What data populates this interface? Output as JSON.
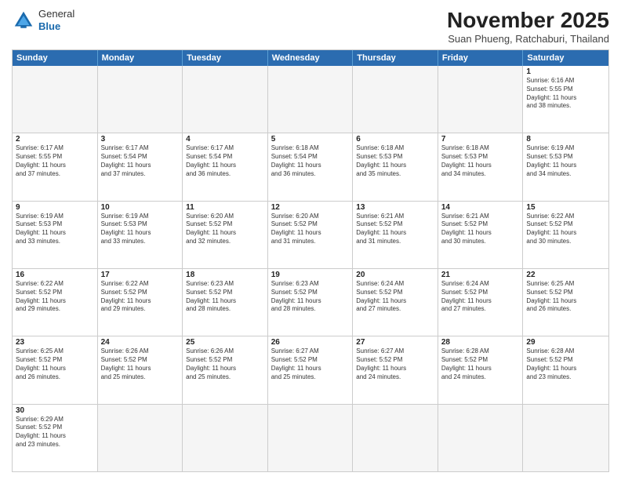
{
  "header": {
    "logo_general": "General",
    "logo_blue": "Blue",
    "month_title": "November 2025",
    "subtitle": "Suan Phueng, Ratchaburi, Thailand"
  },
  "weekdays": [
    "Sunday",
    "Monday",
    "Tuesday",
    "Wednesday",
    "Thursday",
    "Friday",
    "Saturday"
  ],
  "weeks": [
    [
      {
        "day": "",
        "info": ""
      },
      {
        "day": "",
        "info": ""
      },
      {
        "day": "",
        "info": ""
      },
      {
        "day": "",
        "info": ""
      },
      {
        "day": "",
        "info": ""
      },
      {
        "day": "",
        "info": ""
      },
      {
        "day": "1",
        "info": "Sunrise: 6:16 AM\nSunset: 5:55 PM\nDaylight: 11 hours\nand 38 minutes."
      }
    ],
    [
      {
        "day": "2",
        "info": "Sunrise: 6:17 AM\nSunset: 5:55 PM\nDaylight: 11 hours\nand 37 minutes."
      },
      {
        "day": "3",
        "info": "Sunrise: 6:17 AM\nSunset: 5:54 PM\nDaylight: 11 hours\nand 37 minutes."
      },
      {
        "day": "4",
        "info": "Sunrise: 6:17 AM\nSunset: 5:54 PM\nDaylight: 11 hours\nand 36 minutes."
      },
      {
        "day": "5",
        "info": "Sunrise: 6:18 AM\nSunset: 5:54 PM\nDaylight: 11 hours\nand 36 minutes."
      },
      {
        "day": "6",
        "info": "Sunrise: 6:18 AM\nSunset: 5:53 PM\nDaylight: 11 hours\nand 35 minutes."
      },
      {
        "day": "7",
        "info": "Sunrise: 6:18 AM\nSunset: 5:53 PM\nDaylight: 11 hours\nand 34 minutes."
      },
      {
        "day": "8",
        "info": "Sunrise: 6:19 AM\nSunset: 5:53 PM\nDaylight: 11 hours\nand 34 minutes."
      }
    ],
    [
      {
        "day": "9",
        "info": "Sunrise: 6:19 AM\nSunset: 5:53 PM\nDaylight: 11 hours\nand 33 minutes."
      },
      {
        "day": "10",
        "info": "Sunrise: 6:19 AM\nSunset: 5:53 PM\nDaylight: 11 hours\nand 33 minutes."
      },
      {
        "day": "11",
        "info": "Sunrise: 6:20 AM\nSunset: 5:52 PM\nDaylight: 11 hours\nand 32 minutes."
      },
      {
        "day": "12",
        "info": "Sunrise: 6:20 AM\nSunset: 5:52 PM\nDaylight: 11 hours\nand 31 minutes."
      },
      {
        "day": "13",
        "info": "Sunrise: 6:21 AM\nSunset: 5:52 PM\nDaylight: 11 hours\nand 31 minutes."
      },
      {
        "day": "14",
        "info": "Sunrise: 6:21 AM\nSunset: 5:52 PM\nDaylight: 11 hours\nand 30 minutes."
      },
      {
        "day": "15",
        "info": "Sunrise: 6:22 AM\nSunset: 5:52 PM\nDaylight: 11 hours\nand 30 minutes."
      }
    ],
    [
      {
        "day": "16",
        "info": "Sunrise: 6:22 AM\nSunset: 5:52 PM\nDaylight: 11 hours\nand 29 minutes."
      },
      {
        "day": "17",
        "info": "Sunrise: 6:22 AM\nSunset: 5:52 PM\nDaylight: 11 hours\nand 29 minutes."
      },
      {
        "day": "18",
        "info": "Sunrise: 6:23 AM\nSunset: 5:52 PM\nDaylight: 11 hours\nand 28 minutes."
      },
      {
        "day": "19",
        "info": "Sunrise: 6:23 AM\nSunset: 5:52 PM\nDaylight: 11 hours\nand 28 minutes."
      },
      {
        "day": "20",
        "info": "Sunrise: 6:24 AM\nSunset: 5:52 PM\nDaylight: 11 hours\nand 27 minutes."
      },
      {
        "day": "21",
        "info": "Sunrise: 6:24 AM\nSunset: 5:52 PM\nDaylight: 11 hours\nand 27 minutes."
      },
      {
        "day": "22",
        "info": "Sunrise: 6:25 AM\nSunset: 5:52 PM\nDaylight: 11 hours\nand 26 minutes."
      }
    ],
    [
      {
        "day": "23",
        "info": "Sunrise: 6:25 AM\nSunset: 5:52 PM\nDaylight: 11 hours\nand 26 minutes."
      },
      {
        "day": "24",
        "info": "Sunrise: 6:26 AM\nSunset: 5:52 PM\nDaylight: 11 hours\nand 25 minutes."
      },
      {
        "day": "25",
        "info": "Sunrise: 6:26 AM\nSunset: 5:52 PM\nDaylight: 11 hours\nand 25 minutes."
      },
      {
        "day": "26",
        "info": "Sunrise: 6:27 AM\nSunset: 5:52 PM\nDaylight: 11 hours\nand 25 minutes."
      },
      {
        "day": "27",
        "info": "Sunrise: 6:27 AM\nSunset: 5:52 PM\nDaylight: 11 hours\nand 24 minutes."
      },
      {
        "day": "28",
        "info": "Sunrise: 6:28 AM\nSunset: 5:52 PM\nDaylight: 11 hours\nand 24 minutes."
      },
      {
        "day": "29",
        "info": "Sunrise: 6:28 AM\nSunset: 5:52 PM\nDaylight: 11 hours\nand 23 minutes."
      }
    ],
    [
      {
        "day": "30",
        "info": "Sunrise: 6:29 AM\nSunset: 5:52 PM\nDaylight: 11 hours\nand 23 minutes."
      },
      {
        "day": "",
        "info": ""
      },
      {
        "day": "",
        "info": ""
      },
      {
        "day": "",
        "info": ""
      },
      {
        "day": "",
        "info": ""
      },
      {
        "day": "",
        "info": ""
      },
      {
        "day": "",
        "info": ""
      }
    ]
  ]
}
